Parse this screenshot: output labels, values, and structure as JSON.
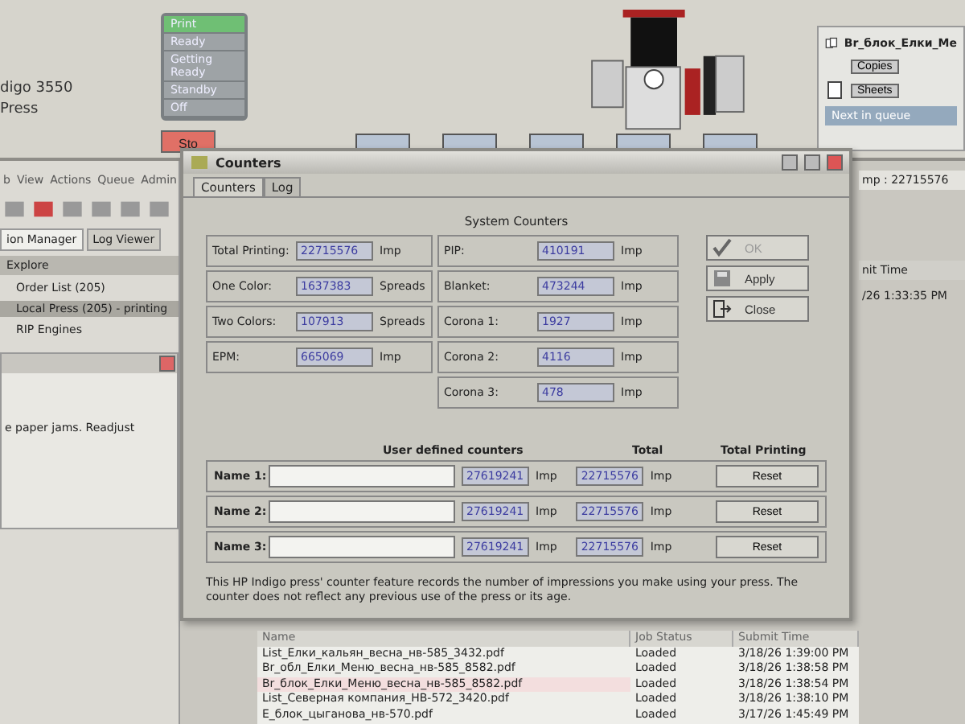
{
  "press": {
    "model_line_1": "digo 3550",
    "model_line_2": "Press"
  },
  "press_states": [
    {
      "label": "Print",
      "selected": true
    },
    {
      "label": "Ready",
      "selected": false
    },
    {
      "label": "Getting Ready",
      "selected": false
    },
    {
      "label": "Standby",
      "selected": false
    },
    {
      "label": "Off",
      "selected": false
    }
  ],
  "stop_button": {
    "label": "Sto"
  },
  "current_job": {
    "name": "Br_блок_Елки_Ме",
    "copies_label": "Copies",
    "sheets_label": "Sheets",
    "next_label": "Next in queue"
  },
  "menu": [
    "b",
    "View",
    "Actions",
    "Queue",
    "Admin"
  ],
  "tabs": [
    {
      "label": "ion Manager",
      "selected": true
    },
    {
      "label": "Log Viewer",
      "selected": false
    }
  ],
  "explorer": {
    "title": "Explore",
    "items": [
      {
        "label": "Order List (205)",
        "selected": false
      },
      {
        "label": "Local Press (205) - printing",
        "selected": true
      },
      {
        "label": "RIP Engines",
        "selected": false
      }
    ]
  },
  "alert": {
    "text": "e paper jams. Readjust"
  },
  "impressions_readout": "mp : 22715576",
  "side_table": {
    "column": "nit Time",
    "value": "/26 1:33:35 PM"
  },
  "dialog": {
    "title": "Counters",
    "tabs": [
      {
        "label": "Counters",
        "selected": true
      },
      {
        "label": "Log",
        "selected": false
      }
    ],
    "heading": "System Counters",
    "left_counters": [
      {
        "label": "Total Printing:",
        "value": "22715576",
        "unit": "Imp"
      },
      {
        "label": "One Color:",
        "value": "1637383",
        "unit": "Spreads"
      },
      {
        "label": "Two Colors:",
        "value": "107913",
        "unit": "Spreads"
      },
      {
        "label": "EPM:",
        "value": "665069",
        "unit": "Imp"
      }
    ],
    "right_counters": [
      {
        "label": "PIP:",
        "value": "410191",
        "unit": "Imp"
      },
      {
        "label": "Blanket:",
        "value": "473244",
        "unit": "Imp"
      },
      {
        "label": "Corona 1:",
        "value": "1927",
        "unit": "Imp"
      },
      {
        "label": "Corona 2:",
        "value": "4116",
        "unit": "Imp"
      },
      {
        "label": "Corona 3:",
        "value": "478",
        "unit": "Imp"
      }
    ],
    "buttons": [
      {
        "kind": "ok",
        "label": "OK",
        "disabled": true
      },
      {
        "kind": "apply",
        "label": "Apply",
        "disabled": false
      },
      {
        "kind": "close",
        "label": "Close",
        "disabled": false
      }
    ],
    "user_columns": [
      "User defined counters",
      "Total",
      "Total Printing"
    ],
    "user_counters": [
      {
        "label": "Name 1:",
        "total": "27619241",
        "total_unit": "Imp",
        "printing": "22715576",
        "printing_unit": "Imp",
        "button": "Reset"
      },
      {
        "label": "Name 2:",
        "total": "27619241",
        "total_unit": "Imp",
        "printing": "22715576",
        "printing_unit": "Imp",
        "button": "Reset"
      },
      {
        "label": "Name 3:",
        "total": "27619241",
        "total_unit": "Imp",
        "printing": "22715576",
        "printing_unit": "Imp",
        "button": "Reset"
      }
    ],
    "note": "This HP Indigo press' counter feature records the number of impressions you make using your press. The counter does not reflect any previous use of the press or its age."
  },
  "jobs": {
    "columns": [
      "Name",
      "Job Status",
      "Submit Time"
    ],
    "rows": [
      {
        "name": "List_Елки_кальян_весна_нв-585_3432.pdf",
        "status": "Loaded",
        "time": "3/18/26 1:39:00 PM",
        "flagged": false
      },
      {
        "name": "Br_обл_Елки_Меню_весна_нв-585_8582.pdf",
        "status": "Loaded",
        "time": "3/18/26 1:38:58 PM",
        "flagged": false
      },
      {
        "name": "Br_блок_Елки_Меню_весна_нв-585_8582.pdf",
        "status": "Loaded",
        "time": "3/18/26 1:38:54 PM",
        "flagged": true
      },
      {
        "name": "List_Северная компания_НВ-572_3420.pdf",
        "status": "Loaded",
        "time": "3/18/26 1:38:10 PM",
        "flagged": false
      },
      {
        "name": "Е_блок_цыганова_нв-570.pdf",
        "status": "Loaded",
        "time": "3/17/26 1:45:49 PM",
        "flagged": false
      }
    ]
  }
}
